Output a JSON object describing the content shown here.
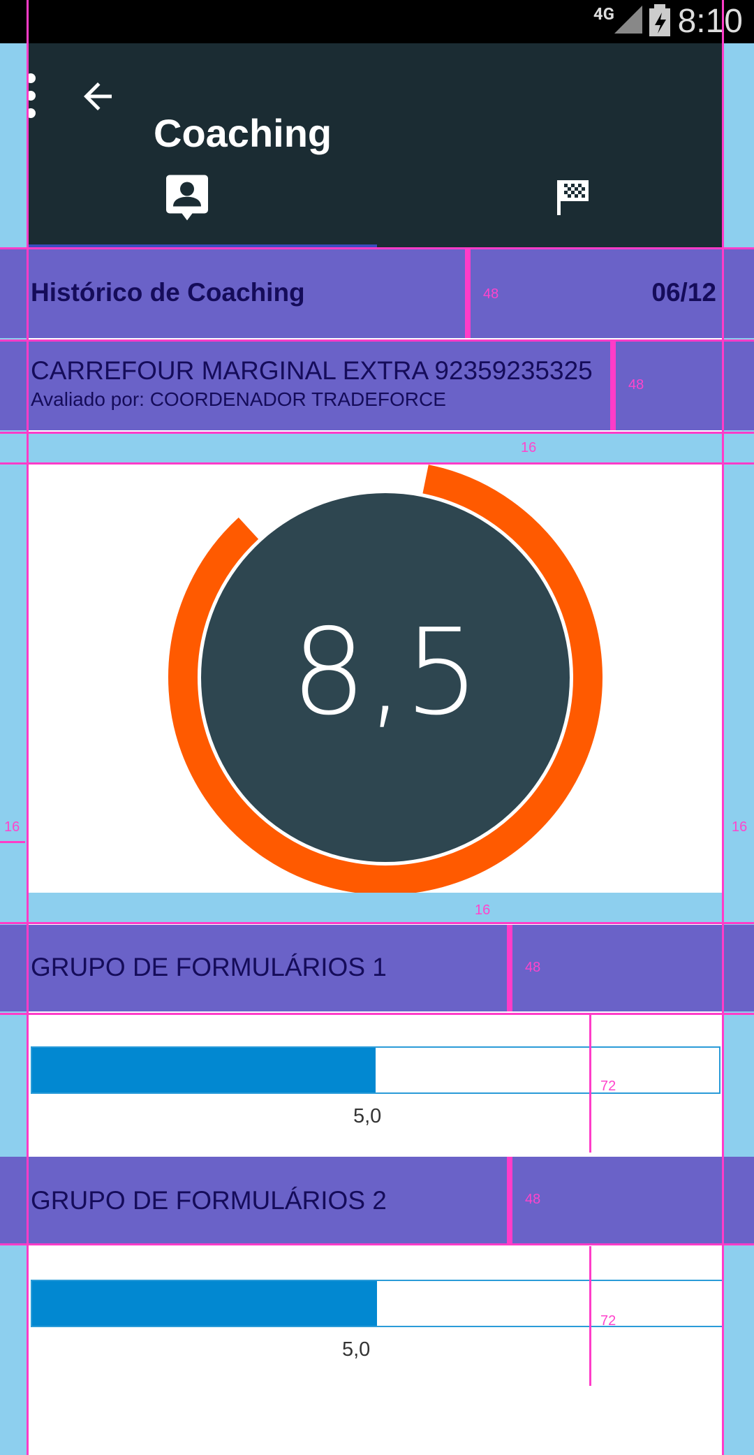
{
  "status_bar": {
    "network": "4G",
    "time": "8:10"
  },
  "app_bar": {
    "title": "Coaching",
    "tabs": [
      {
        "icon": "contact-icon"
      },
      {
        "icon": "flag-checkered-icon"
      }
    ]
  },
  "header": {
    "title": "Histórico de Coaching",
    "date": "06/12"
  },
  "store": {
    "name": "CARREFOUR MARGINAL EXTRA 92359235325",
    "evaluator": "Avaliado por: COORDENADOR TRADEFORCE"
  },
  "score": {
    "value": "8,5",
    "ring_fraction": 0.85
  },
  "groups": [
    {
      "title": "GRUPO DE FORMULÁRIOS 1",
      "value_label": "5,0",
      "fraction": 0.5
    },
    {
      "title": "GRUPO DE FORMULÁRIOS 2",
      "value_label": "5,0",
      "fraction": 0.5
    }
  ],
  "guides": {
    "g48": "48",
    "g16": "16",
    "g72": "72"
  },
  "colors": {
    "ring": "#ff5a00",
    "circle": "#2e4650",
    "bar": "#0288d1",
    "appbar": "#1b2c33"
  }
}
